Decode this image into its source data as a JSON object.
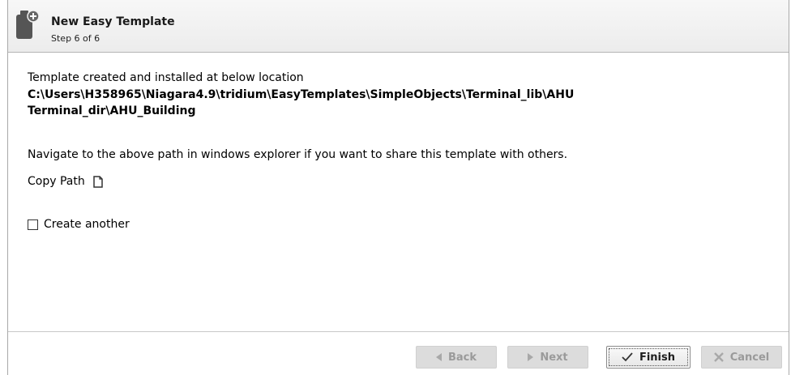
{
  "header": {
    "title": "New Easy Template",
    "step": "Step 6 of 6",
    "icon": "template-add-icon"
  },
  "body": {
    "message": "Template created and installed at below location",
    "path_line1": "C:\\Users\\H358965\\Niagara4.9\\tridium\\EasyTemplates\\SimpleObjects\\Terminal_lib\\AHU",
    "path_line2": "Terminal_dir\\AHU_Building",
    "hint": "Navigate to the above path in windows explorer if you want to share this template with others.",
    "copy_label": "Copy Path",
    "copy_icon": "copy-icon",
    "checkbox_label": "Create another",
    "checkbox_checked": false
  },
  "footer": {
    "back_label": "Back",
    "next_label": "Next",
    "finish_label": "Finish",
    "cancel_label": "Cancel"
  }
}
